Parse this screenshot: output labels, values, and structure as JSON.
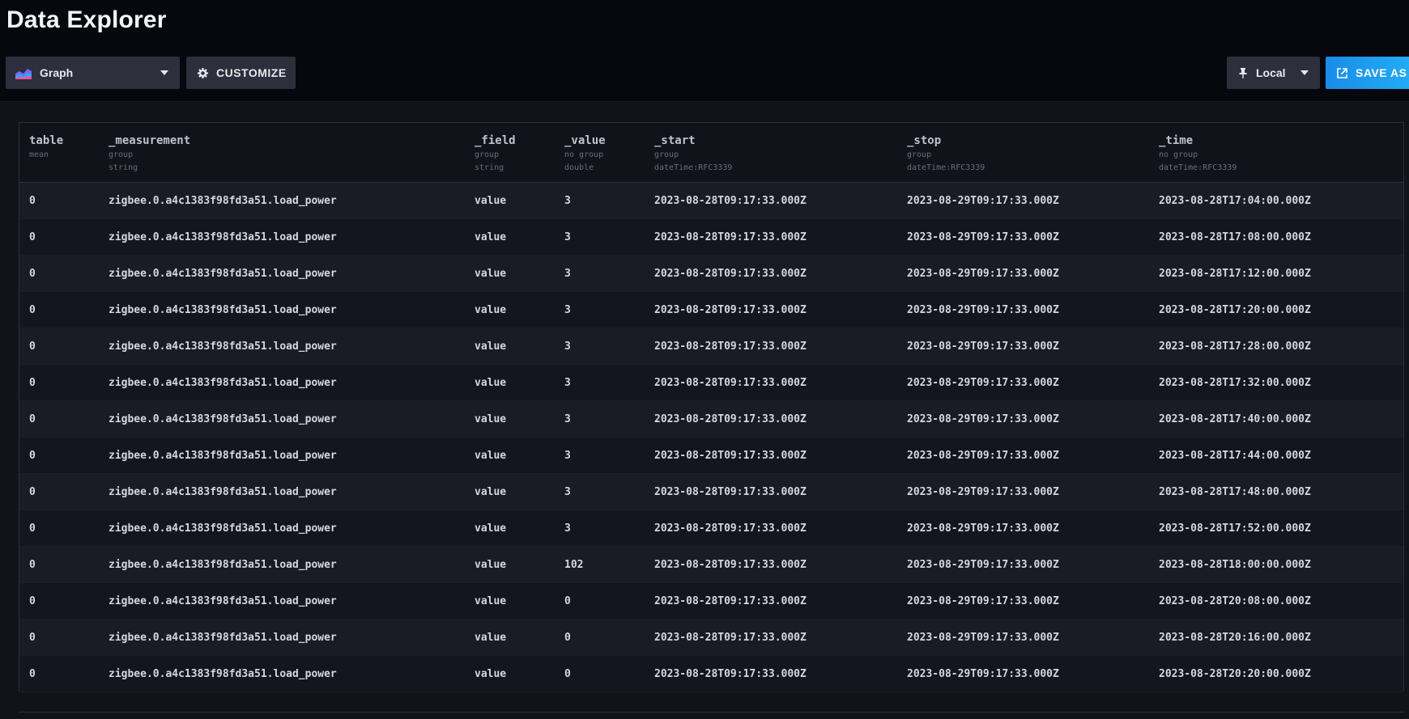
{
  "page": {
    "title": "Data Explorer"
  },
  "toolbar": {
    "view_type": {
      "label": "Graph",
      "icon": "graph-icon"
    },
    "customize": {
      "label": "CUSTOMIZE",
      "icon": "gear-icon"
    },
    "timezone": {
      "label": "Local",
      "icon": "pin-icon"
    },
    "save_as": {
      "label": "SAVE AS",
      "icon": "export-icon"
    }
  },
  "colors": {
    "background": "#07070e",
    "panel": "#12121a",
    "button": "#2e2f3c",
    "accent": "#22adf6"
  },
  "table": {
    "columns": [
      {
        "name": "table",
        "sub1": "mean",
        "sub2": ""
      },
      {
        "name": "_measurement",
        "sub1": "group",
        "sub2": "string"
      },
      {
        "name": "_field",
        "sub1": "group",
        "sub2": "string"
      },
      {
        "name": "_value",
        "sub1": "no group",
        "sub2": "double"
      },
      {
        "name": "_start",
        "sub1": "group",
        "sub2": "dateTime:RFC3339"
      },
      {
        "name": "_stop",
        "sub1": "group",
        "sub2": "dateTime:RFC3339"
      },
      {
        "name": "_time",
        "sub1": "no group",
        "sub2": "dateTime:RFC3339"
      }
    ],
    "rows": [
      [
        "0",
        "zigbee.0.a4c1383f98fd3a51.load_power",
        "value",
        "3",
        "2023-08-28T09:17:33.000Z",
        "2023-08-29T09:17:33.000Z",
        "2023-08-28T17:04:00.000Z"
      ],
      [
        "0",
        "zigbee.0.a4c1383f98fd3a51.load_power",
        "value",
        "3",
        "2023-08-28T09:17:33.000Z",
        "2023-08-29T09:17:33.000Z",
        "2023-08-28T17:08:00.000Z"
      ],
      [
        "0",
        "zigbee.0.a4c1383f98fd3a51.load_power",
        "value",
        "3",
        "2023-08-28T09:17:33.000Z",
        "2023-08-29T09:17:33.000Z",
        "2023-08-28T17:12:00.000Z"
      ],
      [
        "0",
        "zigbee.0.a4c1383f98fd3a51.load_power",
        "value",
        "3",
        "2023-08-28T09:17:33.000Z",
        "2023-08-29T09:17:33.000Z",
        "2023-08-28T17:20:00.000Z"
      ],
      [
        "0",
        "zigbee.0.a4c1383f98fd3a51.load_power",
        "value",
        "3",
        "2023-08-28T09:17:33.000Z",
        "2023-08-29T09:17:33.000Z",
        "2023-08-28T17:28:00.000Z"
      ],
      [
        "0",
        "zigbee.0.a4c1383f98fd3a51.load_power",
        "value",
        "3",
        "2023-08-28T09:17:33.000Z",
        "2023-08-29T09:17:33.000Z",
        "2023-08-28T17:32:00.000Z"
      ],
      [
        "0",
        "zigbee.0.a4c1383f98fd3a51.load_power",
        "value",
        "3",
        "2023-08-28T09:17:33.000Z",
        "2023-08-29T09:17:33.000Z",
        "2023-08-28T17:40:00.000Z"
      ],
      [
        "0",
        "zigbee.0.a4c1383f98fd3a51.load_power",
        "value",
        "3",
        "2023-08-28T09:17:33.000Z",
        "2023-08-29T09:17:33.000Z",
        "2023-08-28T17:44:00.000Z"
      ],
      [
        "0",
        "zigbee.0.a4c1383f98fd3a51.load_power",
        "value",
        "3",
        "2023-08-28T09:17:33.000Z",
        "2023-08-29T09:17:33.000Z",
        "2023-08-28T17:48:00.000Z"
      ],
      [
        "0",
        "zigbee.0.a4c1383f98fd3a51.load_power",
        "value",
        "3",
        "2023-08-28T09:17:33.000Z",
        "2023-08-29T09:17:33.000Z",
        "2023-08-28T17:52:00.000Z"
      ],
      [
        "0",
        "zigbee.0.a4c1383f98fd3a51.load_power",
        "value",
        "102",
        "2023-08-28T09:17:33.000Z",
        "2023-08-29T09:17:33.000Z",
        "2023-08-28T18:00:00.000Z"
      ],
      [
        "0",
        "zigbee.0.a4c1383f98fd3a51.load_power",
        "value",
        "0",
        "2023-08-28T09:17:33.000Z",
        "2023-08-29T09:17:33.000Z",
        "2023-08-28T20:08:00.000Z"
      ],
      [
        "0",
        "zigbee.0.a4c1383f98fd3a51.load_power",
        "value",
        "0",
        "2023-08-28T09:17:33.000Z",
        "2023-08-29T09:17:33.000Z",
        "2023-08-28T20:16:00.000Z"
      ],
      [
        "0",
        "zigbee.0.a4c1383f98fd3a51.load_power",
        "value",
        "0",
        "2023-08-28T09:17:33.000Z",
        "2023-08-29T09:17:33.000Z",
        "2023-08-28T20:20:00.000Z"
      ]
    ]
  }
}
